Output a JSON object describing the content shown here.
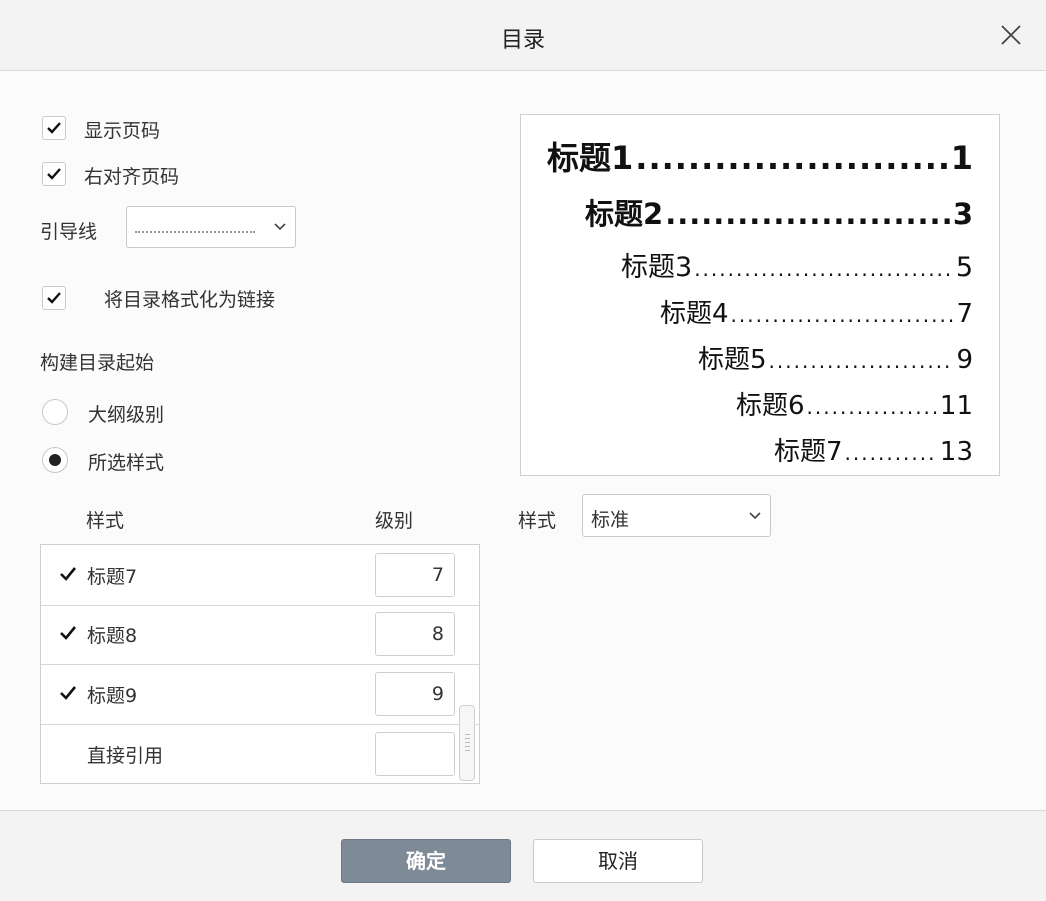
{
  "dialog": {
    "title": "目录"
  },
  "options": {
    "show_page_numbers": {
      "label": "显示页码",
      "checked": true
    },
    "right_align_page_numbers": {
      "label": "右对齐页码",
      "checked": true
    },
    "leader_label": "引导线",
    "leader_value": "...................",
    "format_as_links": {
      "label": "将目录格式化为链接",
      "checked": true
    }
  },
  "build_from": {
    "label": "构建目录起始",
    "radios": [
      {
        "label": "大纲级别",
        "selected": false
      },
      {
        "label": "所选样式",
        "selected": true
      }
    ]
  },
  "preview": {
    "entries": [
      {
        "text": "标题1",
        "page": "1"
      },
      {
        "text": "标题2",
        "page": "3"
      },
      {
        "text": "标题3",
        "page": "5"
      },
      {
        "text": "标题4",
        "page": "7"
      },
      {
        "text": "标题5",
        "page": "9"
      },
      {
        "text": "标题6",
        "page": "11"
      },
      {
        "text": "标题7",
        "page": "13"
      }
    ]
  },
  "styles_table": {
    "col_style": "样式",
    "col_level": "级别",
    "rows": [
      {
        "name": "标题7",
        "checked": true,
        "level": "7"
      },
      {
        "name": "标题8",
        "checked": true,
        "level": "8"
      },
      {
        "name": "标题9",
        "checked": true,
        "level": "9"
      },
      {
        "name": "直接引用",
        "checked": false,
        "level": ""
      }
    ]
  },
  "format": {
    "label": "样式",
    "value": "标准"
  },
  "buttons": {
    "ok": "确定",
    "cancel": "取消"
  },
  "colors": {
    "ok_button": "#7e8a96",
    "border": "#cfcfcf"
  }
}
